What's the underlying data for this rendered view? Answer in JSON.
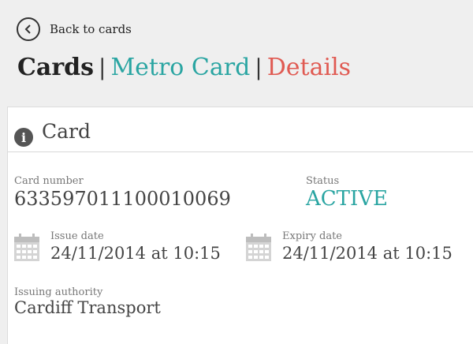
{
  "nav": {
    "back_label": "Back to cards"
  },
  "breadcrumb": {
    "cards": "Cards",
    "separator": "|",
    "metro_card": "Metro Card",
    "details": "Details"
  },
  "card_panel": {
    "title": "Card",
    "card_number_label": "Card number",
    "card_number": "633597011100010069",
    "status_label": "Status",
    "status": "ACTIVE",
    "issue_date_label": "Issue date",
    "issue_date": "24/11/2014 at 10:15",
    "expiry_date_label": "Expiry date",
    "expiry_date": "24/11/2014 at 10:15",
    "issuing_authority_label": "Issuing authority",
    "issuing_authority": "Cardiff Transport"
  },
  "colors": {
    "accent_teal": "#2aa5a2",
    "accent_red": "#e05a52",
    "background": "#efefef"
  },
  "icons": [
    "chevron-left-icon",
    "info-icon",
    "calendar-icon"
  ]
}
